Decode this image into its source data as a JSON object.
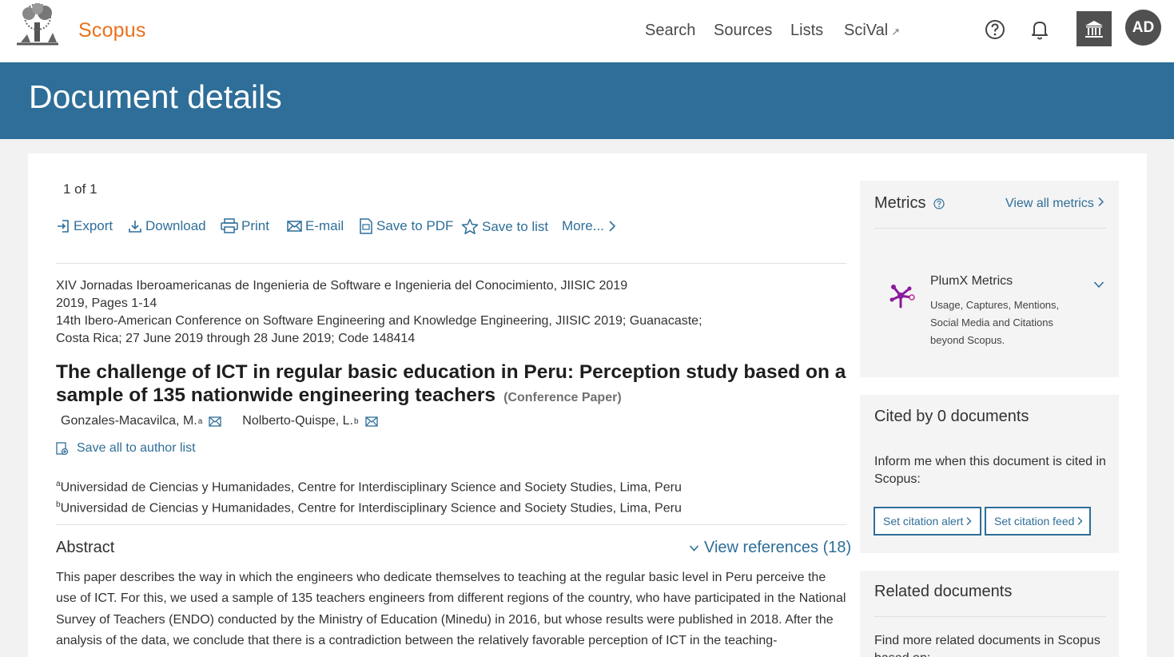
{
  "header": {
    "brand": "Scopus",
    "nav": {
      "search": "Search",
      "sources": "Sources",
      "lists": "Lists",
      "scival": "SciVal",
      "scival_ext": "↗"
    },
    "avatar_initials": "AD",
    "icons": [
      "elsevier-tree-logo",
      "help-icon",
      "bell-icon",
      "institution-icon"
    ]
  },
  "banner": {
    "title": "Document details"
  },
  "pager": "1  of  1",
  "toolbar": {
    "export": "Export",
    "download": "Download",
    "print": "Print",
    "email": "E-mail",
    "save_pdf": "Save to PDF",
    "save_list": "Save to list",
    "more": "More..."
  },
  "source": {
    "line1": "XIV Jornadas Iberoamericanas de Ingenieria de Software e Ingenieria del Conocimiento, JIISIC 2019",
    "line2": "2019, Pages 1-14",
    "line3": "14th Ibero-American Conference on Software Engineering and Knowledge Engineering, JIISIC 2019; Guanacaste;",
    "line4": "Costa Rica; 27 June 2019 through 28 June 2019; Code 148414"
  },
  "document": {
    "title": "The challenge of ICT in regular basic education in Peru: Perception study based on a sample of 135 nationwide engineering teachers",
    "type": "(Conference Paper)"
  },
  "authors": [
    {
      "name": "Gonzales-Macavilca, M.",
      "sup": "a"
    },
    {
      "name": "Nolberto-Quispe, L.",
      "sup": "b"
    }
  ],
  "save_all_authors": "Save all to author list",
  "affiliations": [
    {
      "sup": "a",
      "text": "Universidad de Ciencias y Humanidades, Centre for Interdisciplinary Science and Society Studies, Lima, Peru"
    },
    {
      "sup": "b",
      "text": "Universidad de Ciencias y Humanidades, Centre for Interdisciplinary Science and Society Studies, Lima, Peru"
    }
  ],
  "abstract": {
    "heading": "Abstract",
    "view_refs": "View references (18)",
    "text": "This paper describes the way in which the engineers who dedicate themselves to teaching at the regular basic level in Peru perceive the use of ICT. For this, we used a sample of 135 teachers engineers from different regions of the country, who have participated in the National Survey of Teachers (ENDO) conducted by the Ministry of Education (Minedu) in 2016, but whose results were published in 2018. After the analysis of the data, we conclude that there is a contradiction between the relatively favorable perception of ICT in the teaching-"
  },
  "metrics": {
    "heading": "Metrics",
    "view_all": "View all metrics",
    "plumx_title": "PlumX Metrics",
    "plumx_desc": "Usage, Captures, Mentions, Social Media and Citations beyond Scopus."
  },
  "cited": {
    "heading": "Cited by 0 documents",
    "text": "Inform me when this document is cited in Scopus:",
    "alert_btn": "Set citation alert",
    "feed_btn": "Set citation feed"
  },
  "related": {
    "heading": "Related documents",
    "text": "Find more related documents in Scopus based on:"
  },
  "colors": {
    "brand_orange": "#e9711c",
    "banner_blue": "#2e6e98",
    "link_blue": "#2e6e98",
    "plumx_purple": "#8a1a9b"
  }
}
